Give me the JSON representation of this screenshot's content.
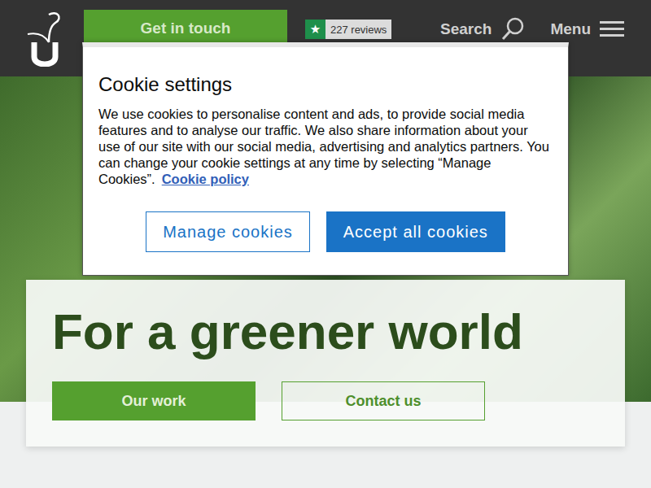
{
  "header": {
    "get_in_touch": "Get in touch",
    "reviews": {
      "star": "★",
      "count": "227 reviews"
    },
    "search": "Search",
    "menu": "Menu"
  },
  "hero": {
    "heading": "For a greener world",
    "buttons": [
      {
        "label": "Our work",
        "kind": "filled"
      },
      {
        "label": "Contact us",
        "kind": "outline"
      }
    ]
  },
  "cookie_dialog": {
    "title": "Cookie settings",
    "body": "We use cookies to personalise content and ads, to provide social media features and to analyse our traffic. We also share information about your use of our site with our social media, advertising and analytics partners. You can change your cookie settings at any time by selecting “Manage Cookies”.",
    "link": "Cookie policy",
    "buttons": [
      {
        "label": "Manage cookies",
        "kind": "outline"
      },
      {
        "label": "Accept all cookies",
        "kind": "filled"
      }
    ]
  }
}
